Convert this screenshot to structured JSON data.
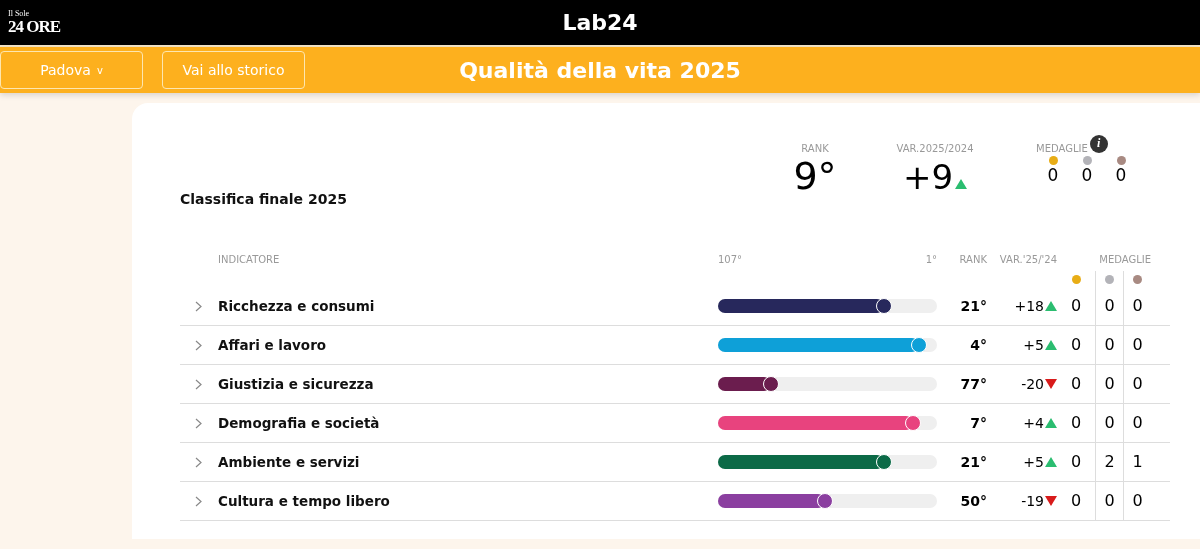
{
  "header": {
    "brand": "24 ORE",
    "brand_small": "Il Sole",
    "logo": "Lab24"
  },
  "toolbar": {
    "city": "Padova",
    "city_caret": "v",
    "history_button": "Vai allo storico",
    "title": "Qualità della vita 2025"
  },
  "summary": {
    "title": "Classifica finale 2025",
    "rank_label": "RANK",
    "rank": "9°",
    "var_label": "VAR.2025/2024",
    "var": "+9",
    "var_up": true,
    "medals_label": "MEDAGLIE",
    "info": "i",
    "medals": [
      {
        "color": "#e8ad16",
        "count": "0"
      },
      {
        "color": "#b3b3b8",
        "count": "0"
      },
      {
        "color": "#a88a82",
        "count": "0"
      }
    ]
  },
  "table": {
    "columns": {
      "indicator": "INDICATORE",
      "worst": "107°",
      "best": "1°",
      "rank": "RANK",
      "var": "VAR.'25/'24",
      "medals": "MEDAGLIE"
    },
    "medal_dots": [
      {
        "color": "#e8ad16"
      },
      {
        "color": "#b3b3b8"
      },
      {
        "color": "#a88a82"
      }
    ],
    "rows": [
      {
        "name": "Ricchezza e consumi",
        "color": "#27285c",
        "level": 0.76,
        "rank": "21°",
        "var": "+18",
        "up": true,
        "medals": [
          "0",
          "0",
          "0"
        ]
      },
      {
        "name": "Affari e lavoro",
        "color": "#0ea0d8",
        "level": 0.92,
        "rank": "4°",
        "var": "+5",
        "up": true,
        "medals": [
          "0",
          "0",
          "0"
        ]
      },
      {
        "name": "Giustizia e sicurezza",
        "color": "#6b1d4e",
        "level": 0.24,
        "rank": "77°",
        "var": "-20",
        "up": false,
        "medals": [
          "0",
          "0",
          "0"
        ]
      },
      {
        "name": "Demografia e società",
        "color": "#e8437e",
        "level": 0.89,
        "rank": "7°",
        "var": "+4",
        "up": true,
        "medals": [
          "0",
          "0",
          "0"
        ]
      },
      {
        "name": "Ambiente e servizi",
        "color": "#0c6a47",
        "level": 0.76,
        "rank": "21°",
        "var": "+5",
        "up": true,
        "medals": [
          "0",
          "2",
          "1"
        ]
      },
      {
        "name": "Cultura e tempo libero",
        "color": "#8b3fa0",
        "level": 0.49,
        "rank": "50°",
        "var": "-19",
        "up": false,
        "medals": [
          "0",
          "0",
          "0"
        ]
      }
    ]
  }
}
